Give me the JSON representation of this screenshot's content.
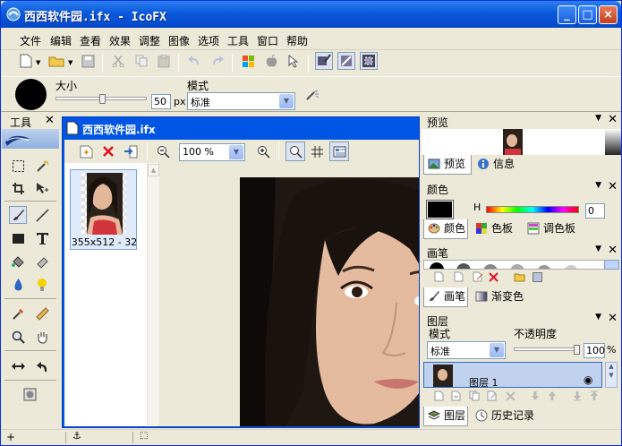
{
  "window": {
    "title": "西西软件园.ifx - IcoFX"
  },
  "menu": [
    "文件",
    "编辑",
    "查看",
    "效果",
    "调整",
    "图像",
    "选项",
    "工具",
    "窗口",
    "帮助"
  ],
  "brush": {
    "size_label": "大小",
    "size_value": "50",
    "size_unit": "px",
    "mode_label": "模式",
    "mode_value": "标准",
    "size_slider_fraction": 0.5
  },
  "tools_panel": {
    "title": "工具"
  },
  "document": {
    "title": "西西软件园.ifx",
    "zoom": "100 %",
    "thumbnail_caption": "355x512 - 32"
  },
  "panels": {
    "preview": {
      "title": "预览",
      "tabs": [
        "预览",
        "信息"
      ]
    },
    "color": {
      "title": "颜色",
      "h_label": "H",
      "h_value": "0",
      "tabs": [
        "颜色",
        "色板",
        "调色板"
      ]
    },
    "brushes": {
      "title": "画笔",
      "tabs": [
        "画笔",
        "渐变色"
      ]
    },
    "layers": {
      "title": "图层",
      "mode_label": "模式",
      "opacity_label": "不透明度",
      "mode_value": "标准",
      "opacity_value": "100",
      "opacity_unit": "%",
      "layer_name": "图层 1",
      "tabs": [
        "图层",
        "历史记录"
      ]
    }
  },
  "colors": {
    "titlebar": "#0a58dc",
    "doc_title": "#0055e5",
    "chrome": "#ece9d8"
  }
}
